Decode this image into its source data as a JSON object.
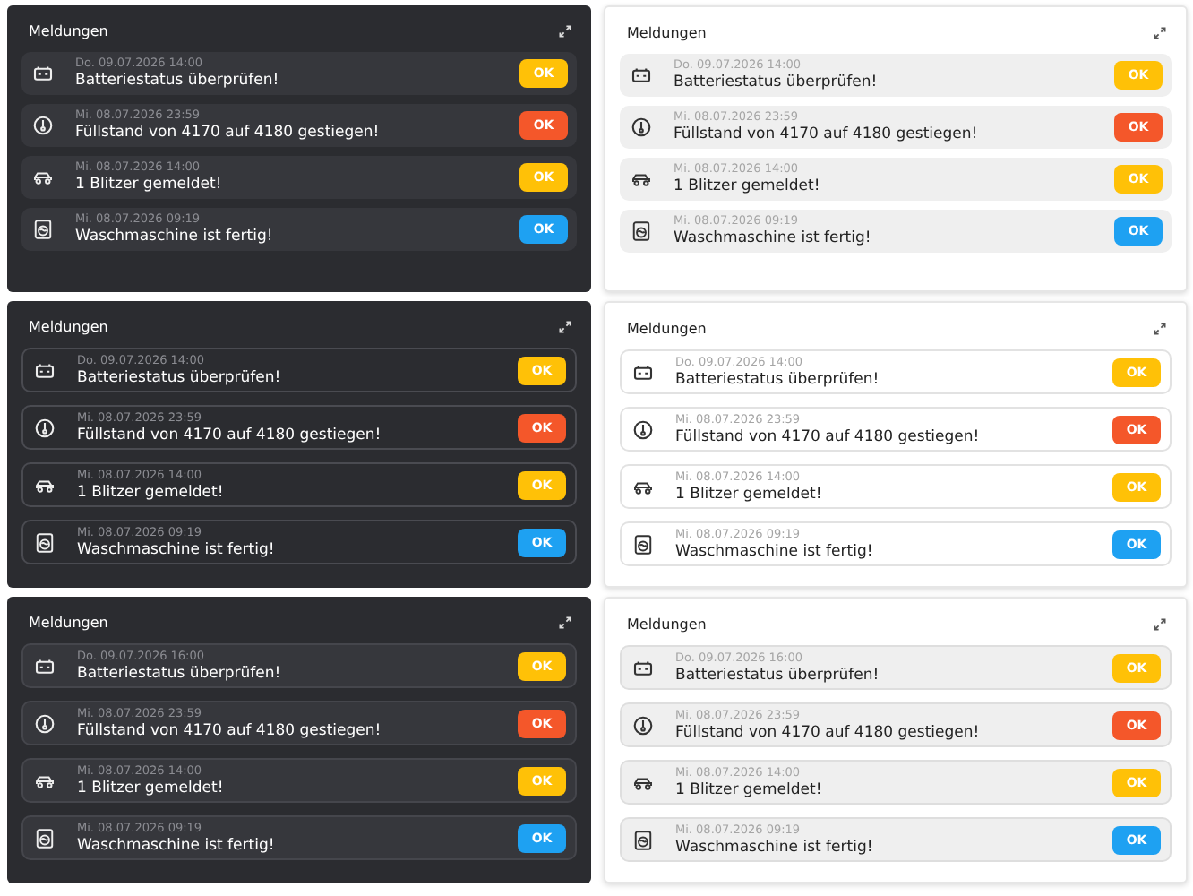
{
  "panels": [
    {
      "title": "Meldungen",
      "items": [
        {
          "kind": "battery",
          "date": "Do. 09.07.2026 14:00",
          "message": "Batteriestatus überprüfen!",
          "button": "OK",
          "color": "#ffc107"
        },
        {
          "kind": "gauge",
          "date": "Mi. 08.07.2026 23:59",
          "message": "Füllstand von 4170 auf 4180 gestiegen!",
          "button": "OK",
          "color": "#f4572a"
        },
        {
          "kind": "car",
          "date": "Mi. 08.07.2026 14:00",
          "message": "1 Blitzer gemeldet!",
          "button": "OK",
          "color": "#ffc107"
        },
        {
          "kind": "washer",
          "date": "Mi. 08.07.2026 09:19",
          "message": "Waschmaschine ist fertig!",
          "button": "OK",
          "color": "#1ea1f2"
        }
      ]
    },
    {
      "title": "Meldungen",
      "items": [
        {
          "kind": "battery",
          "date": "Do. 09.07.2026 14:00",
          "message": "Batteriestatus überprüfen!",
          "button": "OK",
          "color": "#ffc107"
        },
        {
          "kind": "gauge",
          "date": "Mi. 08.07.2026 23:59",
          "message": "Füllstand von 4170 auf 4180 gestiegen!",
          "button": "OK",
          "color": "#f4572a"
        },
        {
          "kind": "car",
          "date": "Mi. 08.07.2026 14:00",
          "message": "1 Blitzer gemeldet!",
          "button": "OK",
          "color": "#ffc107"
        },
        {
          "kind": "washer",
          "date": "Mi. 08.07.2026 09:19",
          "message": "Waschmaschine ist fertig!",
          "button": "OK",
          "color": "#1ea1f2"
        }
      ]
    },
    {
      "title": "Meldungen",
      "items": [
        {
          "kind": "battery",
          "date": "Do. 09.07.2026 14:00",
          "message": "Batteriestatus überprüfen!",
          "button": "OK",
          "color": "#ffc107"
        },
        {
          "kind": "gauge",
          "date": "Mi. 08.07.2026 23:59",
          "message": "Füllstand von 4170 auf 4180 gestiegen!",
          "button": "OK",
          "color": "#f4572a"
        },
        {
          "kind": "car",
          "date": "Mi. 08.07.2026 14:00",
          "message": "1 Blitzer gemeldet!",
          "button": "OK",
          "color": "#ffc107"
        },
        {
          "kind": "washer",
          "date": "Mi. 08.07.2026 09:19",
          "message": "Waschmaschine ist fertig!",
          "button": "OK",
          "color": "#1ea1f2"
        }
      ]
    },
    {
      "title": "Meldungen",
      "items": [
        {
          "kind": "battery",
          "date": "Do. 09.07.2026 14:00",
          "message": "Batteriestatus überprüfen!",
          "button": "OK",
          "color": "#ffc107"
        },
        {
          "kind": "gauge",
          "date": "Mi. 08.07.2026 23:59",
          "message": "Füllstand von 4170 auf 4180 gestiegen!",
          "button": "OK",
          "color": "#f4572a"
        },
        {
          "kind": "car",
          "date": "Mi. 08.07.2026 14:00",
          "message": "1 Blitzer gemeldet!",
          "button": "OK",
          "color": "#ffc107"
        },
        {
          "kind": "washer",
          "date": "Mi. 08.07.2026 09:19",
          "message": "Waschmaschine ist fertig!",
          "button": "OK",
          "color": "#1ea1f2"
        }
      ]
    },
    {
      "title": "Meldungen",
      "items": [
        {
          "kind": "battery",
          "date": "Do. 09.07.2026 16:00",
          "message": "Batteriestatus überprüfen!",
          "button": "OK",
          "color": "#ffc107"
        },
        {
          "kind": "gauge",
          "date": "Mi. 08.07.2026 23:59",
          "message": "Füllstand von 4170 auf 4180 gestiegen!",
          "button": "OK",
          "color": "#f4572a"
        },
        {
          "kind": "car",
          "date": "Mi. 08.07.2026 14:00",
          "message": "1 Blitzer gemeldet!",
          "button": "OK",
          "color": "#ffc107"
        },
        {
          "kind": "washer",
          "date": "Mi. 08.07.2026 09:19",
          "message": "Waschmaschine ist fertig!",
          "button": "OK",
          "color": "#1ea1f2"
        }
      ]
    },
    {
      "title": "Meldungen",
      "items": [
        {
          "kind": "battery",
          "date": "Do. 09.07.2026 16:00",
          "message": "Batteriestatus überprüfen!",
          "button": "OK",
          "color": "#ffc107"
        },
        {
          "kind": "gauge",
          "date": "Mi. 08.07.2026 23:59",
          "message": "Füllstand von 4170 auf 4180 gestiegen!",
          "button": "OK",
          "color": "#f4572a"
        },
        {
          "kind": "car",
          "date": "Mi. 08.07.2026 14:00",
          "message": "1 Blitzer gemeldet!",
          "button": "OK",
          "color": "#ffc107"
        },
        {
          "kind": "washer",
          "date": "Mi. 08.07.2026 09:19",
          "message": "Waschmaschine ist fertig!",
          "button": "OK",
          "color": "#1ea1f2"
        }
      ]
    }
  ]
}
